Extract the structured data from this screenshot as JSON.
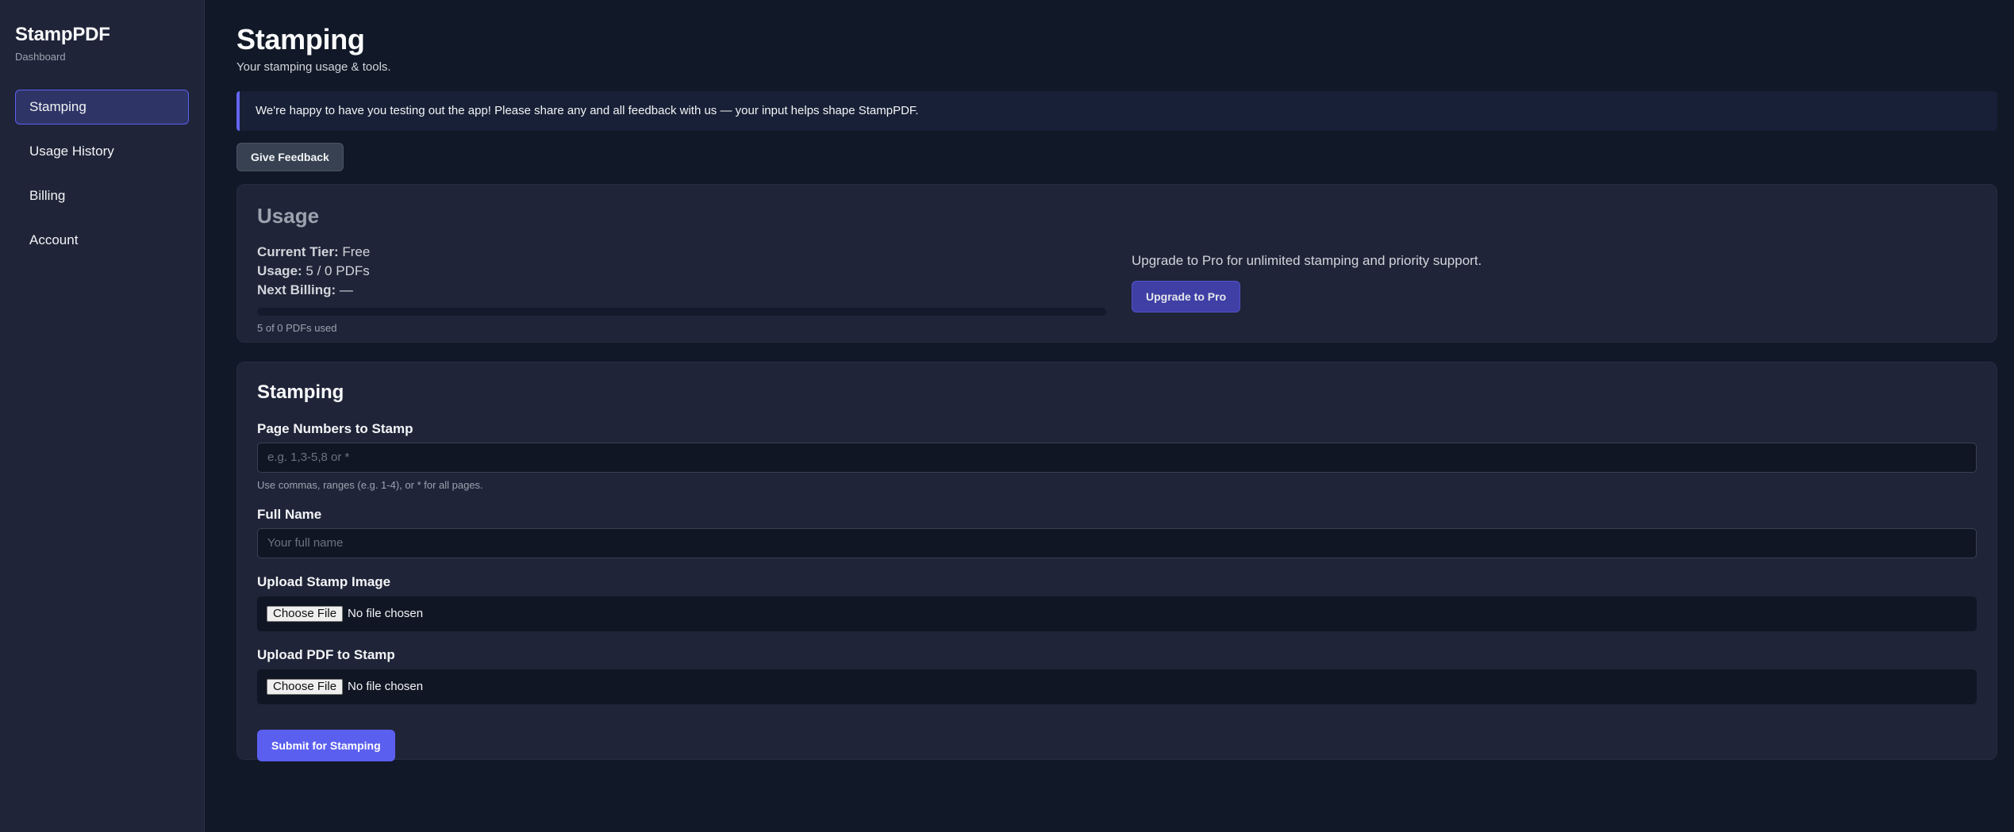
{
  "sidebar": {
    "brand": "StampPDF",
    "subtitle": "Dashboard",
    "items": [
      {
        "label": "Stamping"
      },
      {
        "label": "Usage History"
      },
      {
        "label": "Billing"
      },
      {
        "label": "Account"
      }
    ]
  },
  "header": {
    "title": "Stamping",
    "subtitle": "Your stamping usage & tools."
  },
  "banner": {
    "text": "We're happy to have you testing out the app! Please share any and all feedback with us — your input helps shape StampPDF."
  },
  "feedback_button": "Give Feedback",
  "usage": {
    "heading": "Usage",
    "tier_label": "Current Tier:",
    "tier_value": "Free",
    "usage_label": "Usage:",
    "usage_value": "5 / 0 PDFs",
    "billing_label": "Next Billing:",
    "billing_value": "—",
    "progress_percent": 0,
    "progress_caption": "5 of 0 PDFs used",
    "upgrade_text": "Upgrade to Pro for unlimited stamping and priority support.",
    "upgrade_button": "Upgrade to Pro"
  },
  "stamping": {
    "heading": "Stamping",
    "pages_label": "Page Numbers to Stamp",
    "pages_placeholder": "e.g. 1,3-5,8 or *",
    "pages_help": "Use commas, ranges (e.g. 1-4), or * for all pages.",
    "name_label": "Full Name",
    "name_placeholder": "Your full name",
    "image_label": "Upload Stamp Image",
    "pdf_label": "Upload PDF to Stamp",
    "choose_file": "Choose File",
    "no_file": "No file chosen",
    "submit": "Submit for Stamping"
  },
  "colors": {
    "accent": "#6366f1",
    "sidebar_bg": "#1f2438",
    "page_bg": "#111827"
  }
}
